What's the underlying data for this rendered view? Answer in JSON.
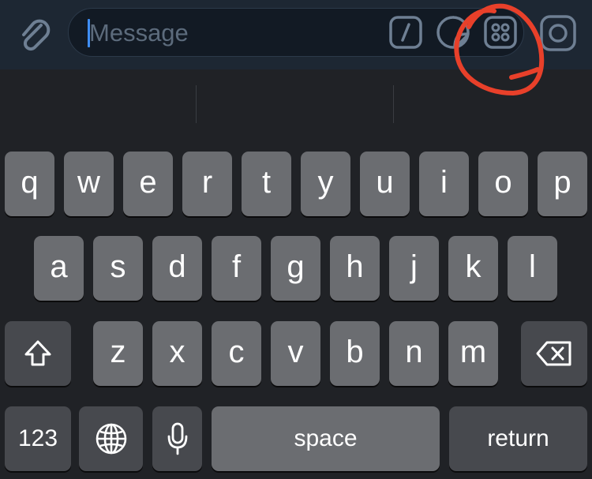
{
  "composer": {
    "placeholder": "Message",
    "attach_icon": "paperclip-icon",
    "commands_icon": "slash-command-icon",
    "sticker_icon": "sticker-icon",
    "apps_icon": "mini-apps-grid-icon",
    "camera_icon": "camera-icon"
  },
  "keyboard": {
    "row1": [
      "q",
      "w",
      "e",
      "r",
      "t",
      "y",
      "u",
      "i",
      "o",
      "p"
    ],
    "row2": [
      "a",
      "s",
      "d",
      "f",
      "g",
      "h",
      "j",
      "k",
      "l"
    ],
    "row3": [
      "z",
      "x",
      "c",
      "v",
      "b",
      "n",
      "m"
    ],
    "numbers_label": "123",
    "space_label": "space",
    "return_label": "return",
    "shift_icon": "shift-arrow-icon",
    "delete_icon": "backspace-icon",
    "globe_icon": "globe-icon",
    "mic_icon": "microphone-icon"
  },
  "colors": {
    "annotation": "#e8402a",
    "caret": "#3f8ef5",
    "key": "#6b6d71",
    "dark_key": "#47494e"
  }
}
